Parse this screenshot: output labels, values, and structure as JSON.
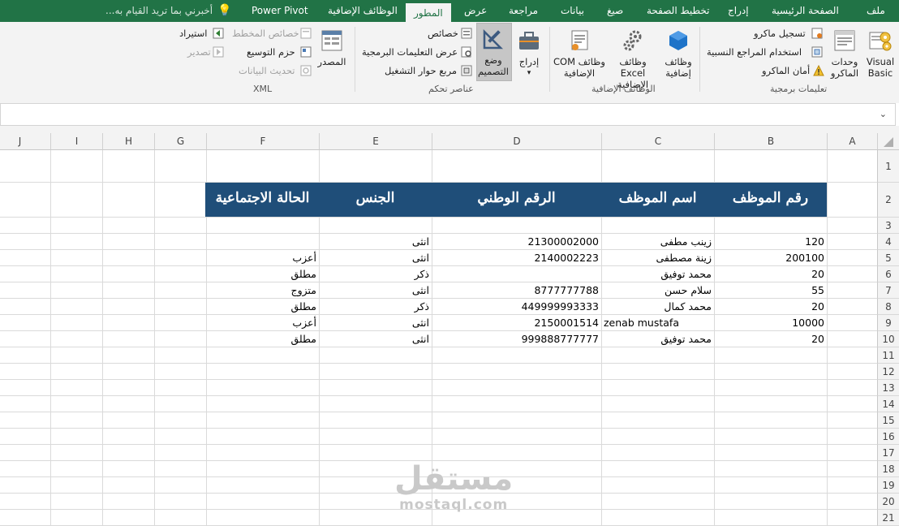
{
  "tabs": [
    "ملف",
    "الصفحة الرئيسية",
    "إدراج",
    "تخطيط الصفحة",
    "صيغ",
    "بيانات",
    "مراجعة",
    "عرض",
    "المطور",
    "الوظائف الإضافية",
    "Power Pivot"
  ],
  "tell_me": "أخبرني بما تريد القيام به...",
  "ribbon": {
    "code_group": {
      "label": "تعليمات برمجية",
      "visual_basic": "Visual Basic",
      "macros": "وحدات الماكرو",
      "record_macro": "تسجيل ماكرو",
      "use_relative": "استخدام المراجع النسبية",
      "macro_security": "أمان الماكرو"
    },
    "addins_group": {
      "label": "الوظائف الإضافية",
      "addins": "وظائف إضافية",
      "excel_addins": "وظائف Excel الإضافية",
      "com_addins": "وظائف COM الإضافية"
    },
    "controls_group": {
      "label": "عناصر تحكم",
      "insert": "إدراج",
      "design_mode": "وضع التصميم",
      "properties": "خصائص",
      "view_code": "عرض التعليمات البرمجية",
      "run_dialog": "مربع حوار التشغيل"
    },
    "xml_group": {
      "label": "XML",
      "source": "المصدر",
      "map_properties": "خصائص المخطط",
      "expansion_packs": "حزم التوسيع",
      "refresh_data": "تحديث البيانات",
      "import": "استيراد",
      "export": "تصدير"
    }
  },
  "columns": [
    "A",
    "B",
    "C",
    "D",
    "E",
    "F",
    "G",
    "H",
    "I",
    "J"
  ],
  "rows": [
    "1",
    "2",
    "3",
    "4",
    "5",
    "6",
    "7",
    "8",
    "9",
    "10",
    "11",
    "12",
    "13",
    "14",
    "15",
    "16",
    "17",
    "18",
    "19",
    "20",
    "21"
  ],
  "header_row": {
    "b": "رقم الموظف",
    "c": "اسم الموظف",
    "d": "الرقم الوطني",
    "e": "الجنس",
    "f": "الحالة الاجتماعية"
  },
  "data_rows": [
    {
      "b": "120",
      "c": "زينب مطفى",
      "d": "21300002000",
      "e": "انثى",
      "f": ""
    },
    {
      "b": "200100",
      "c": "زينة مصطفى",
      "d": "2140002223",
      "e": "انثى",
      "f": "أعزب"
    },
    {
      "b": "20",
      "c": "محمد توفيق",
      "d": "",
      "e": "ذكر",
      "f": "مطلق"
    },
    {
      "b": "55",
      "c": "سلام حسن",
      "d": "8777777788",
      "e": "انثى",
      "f": "متزوج"
    },
    {
      "b": "20",
      "c": "محمد كمال",
      "d": "449999993333",
      "e": "ذكر",
      "f": "مطلق"
    },
    {
      "b": "10000",
      "c": "zenab mustafa",
      "d": "2150001514",
      "e": "انثى",
      "f": "أعزب"
    },
    {
      "b": "20",
      "c": "محمد توفيق",
      "d": "999888777777",
      "e": "انثى",
      "f": "مطلق"
    }
  ],
  "watermark": {
    "arabic": "مستقل",
    "latin": "mostaql.com"
  },
  "colors": {
    "excel_green": "#217346",
    "header_band": "#1f4e79"
  }
}
